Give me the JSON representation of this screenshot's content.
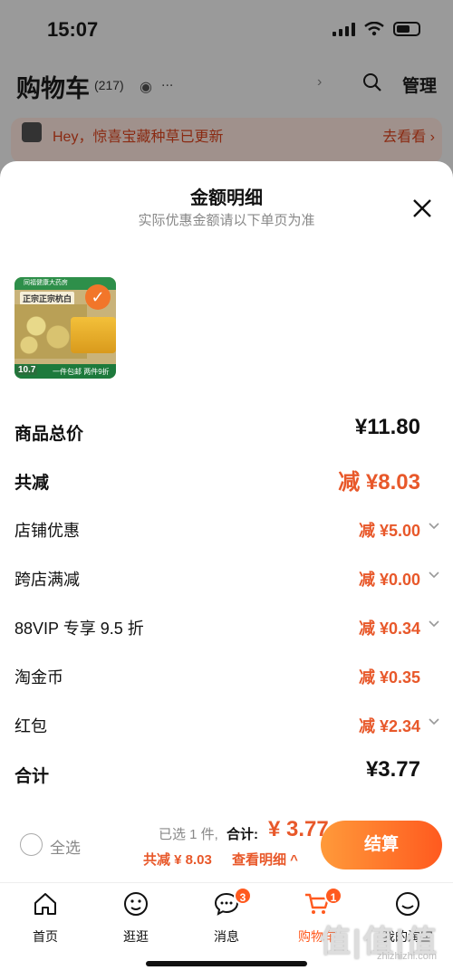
{
  "status_bar": {
    "time": "15:07"
  },
  "background_page": {
    "title": "购物车",
    "count": "(217)",
    "dots": "...",
    "manage_label": "管理",
    "notice_text": "Hey，惊喜宝藏种草已更新",
    "notice_link": "去看看"
  },
  "sheet": {
    "title": "金额明细",
    "subtitle": "实际优惠金额请以下单页为准",
    "product": {
      "headline": "正宗正宗杭白",
      "top_label": "同福健康大药房",
      "price": "10.7",
      "promo": "一件包邮 两件9折"
    },
    "rows": [
      {
        "label": "商品总价",
        "value": "¥11.80",
        "style": "dark-big",
        "has_chevron": false
      },
      {
        "label": "共减",
        "value": "减 ¥8.03",
        "style": "accent-big",
        "has_chevron": false
      },
      {
        "label": "店铺优惠",
        "value": "减 ¥5.00",
        "style": "accent",
        "has_chevron": true
      },
      {
        "label": "跨店满减",
        "value": "减 ¥0.00",
        "style": "accent",
        "has_chevron": true
      },
      {
        "label": "88VIP 专享 9.5 折",
        "value": "减 ¥0.34",
        "style": "accent",
        "has_chevron": true
      },
      {
        "label": "淘金币",
        "value": "减 ¥0.35",
        "style": "accent",
        "has_chevron": false
      },
      {
        "label": "红包",
        "value": "减 ¥2.34",
        "style": "accent",
        "has_chevron": true
      },
      {
        "label": "合计",
        "value": "¥3.77",
        "style": "dark-big",
        "has_chevron": false
      }
    ]
  },
  "checkout": {
    "select_all_label": "全选",
    "selected_count": "已选 1 件,",
    "total_label": "合计:",
    "total_value": "¥ 3.77",
    "discount_summary": "共减 ¥ 8.03",
    "view_detail_label": "查看明细 ^",
    "button_label": "结算"
  },
  "tabs": [
    {
      "label": "首页",
      "icon": "home-icon",
      "badge": ""
    },
    {
      "label": "逛逛",
      "icon": "browse-icon",
      "badge": ""
    },
    {
      "label": "消息",
      "icon": "message-icon",
      "badge": "3"
    },
    {
      "label": "购物车",
      "icon": "cart-icon",
      "badge": "1"
    },
    {
      "label": "我的淘宝",
      "icon": "profile-icon",
      "badge": ""
    }
  ],
  "watermark": {
    "glyphs": "值|值|值",
    "url": "zhizhizhi.com"
  },
  "colors": {
    "accent": "#e8582a",
    "checkout_gradient_start": "#ff9a3a",
    "checkout_gradient_end": "#ff5a1f"
  }
}
